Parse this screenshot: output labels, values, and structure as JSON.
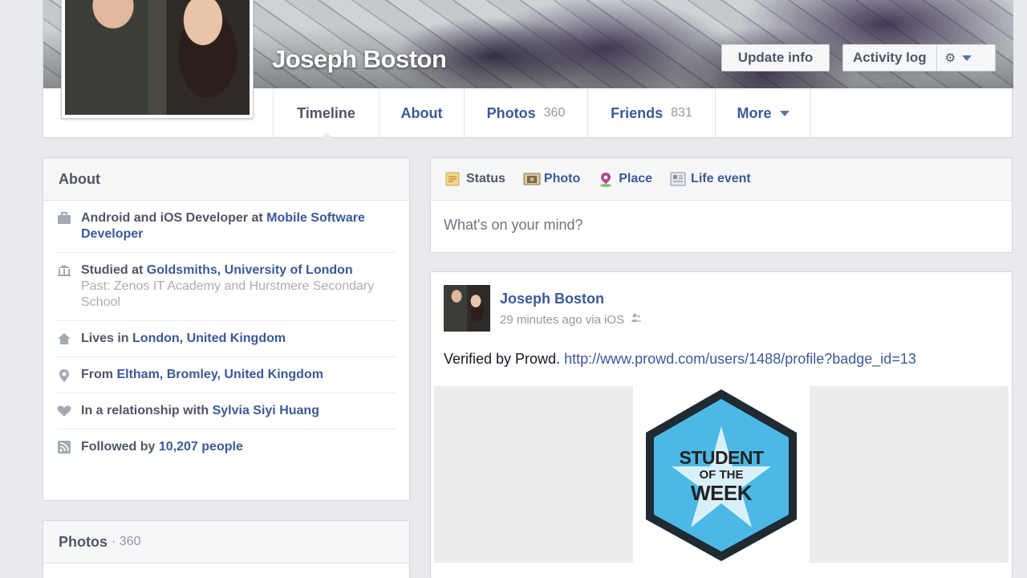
{
  "profile": {
    "name": "Joseph Boston",
    "update_info_label": "Update info",
    "activity_log_label": "Activity log",
    "settings_icon": "gear-icon"
  },
  "tabs": [
    {
      "label": "Timeline",
      "count": ""
    },
    {
      "label": "About",
      "count": ""
    },
    {
      "label": "Photos",
      "count": "360"
    },
    {
      "label": "Friends",
      "count": "831"
    },
    {
      "label": "More",
      "count": ""
    }
  ],
  "about": {
    "title": "About",
    "items": [
      {
        "icon": "briefcase-icon",
        "prefix": "Android and iOS Developer at ",
        "link": "Mobile Software Developer",
        "suffix": "",
        "sub": ""
      },
      {
        "icon": "school-icon",
        "prefix": "Studied at ",
        "link": "Goldsmiths, University of London",
        "suffix": "",
        "sub": "Past: Zenos IT Academy and Hurstmere Secondary School"
      },
      {
        "icon": "home-icon",
        "prefix": "Lives in ",
        "link": "London, United Kingdom",
        "suffix": "",
        "sub": ""
      },
      {
        "icon": "location-pin-icon",
        "prefix": "From ",
        "link": "Eltham, Bromley, United Kingdom",
        "suffix": "",
        "sub": ""
      },
      {
        "icon": "heart-icon",
        "prefix": "In a relationship with ",
        "link": "Sylvia Siyi Huang",
        "suffix": "",
        "sub": ""
      },
      {
        "icon": "rss-icon",
        "prefix": "Followed by ",
        "link": "10,207 people",
        "suffix": "",
        "sub": ""
      }
    ]
  },
  "photos_card": {
    "title": "Photos",
    "count": "· 360"
  },
  "composer": {
    "tabs": [
      {
        "label": "Status",
        "icon": "status-icon"
      },
      {
        "label": "Photo",
        "icon": "photo-icon"
      },
      {
        "label": "Place",
        "icon": "place-icon"
      },
      {
        "label": "Life event",
        "icon": "life-event-icon"
      }
    ],
    "placeholder": "What's on your mind?"
  },
  "post": {
    "author": "Joseph Boston",
    "meta": "29 minutes ago via iOS",
    "text": "Verified by Prowd. ",
    "link": "http://www.prowd.com/users/1488/profile?badge_id=13",
    "badge": {
      "line1": "STUDENT",
      "line2": "OF THE",
      "line3": "WEEK",
      "color": "#4cb8e6"
    }
  },
  "colors": {
    "link": "#3b5998",
    "background": "#e9eaed"
  }
}
